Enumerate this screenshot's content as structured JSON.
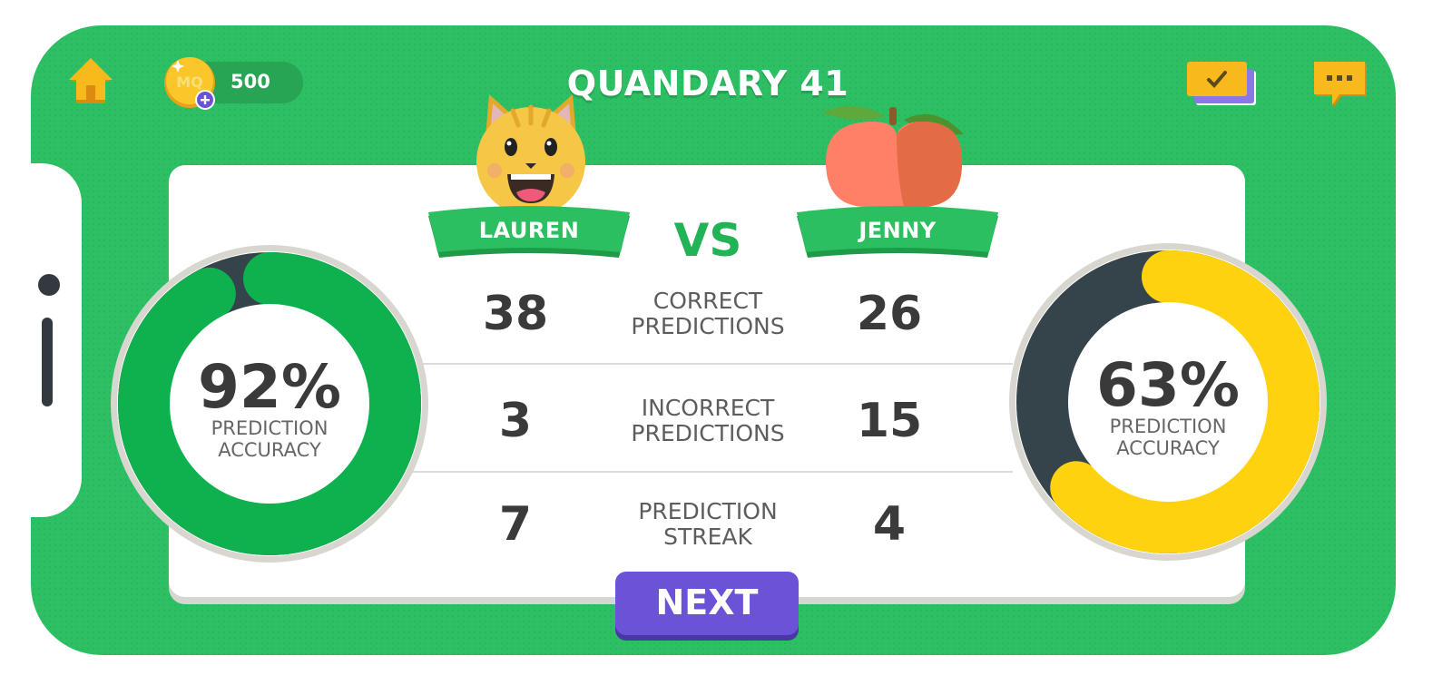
{
  "header": {
    "title": "QUANDARY 41",
    "coins": "500",
    "coin_logo_text": "MQ",
    "icons": [
      "home-icon",
      "coin-icon",
      "cards-icon",
      "chat-icon"
    ]
  },
  "players": {
    "left": {
      "name": "LAUREN",
      "avatar": "cat-emoji-icon",
      "accuracy": "92%",
      "accuracy_value": 0.92
    },
    "right": {
      "name": "JENNY",
      "avatar": "peach-emoji-icon",
      "accuracy": "63%",
      "accuracy_value": 0.63
    },
    "vs": "VS"
  },
  "stats": [
    {
      "label": "CORRECT\nPREDICTIONS",
      "left": "38",
      "right": "26"
    },
    {
      "label": "INCORRECT\nPREDICTIONS",
      "left": "3",
      "right": "15"
    },
    {
      "label": "PREDICTION\nSTREAK",
      "left": "7",
      "right": "4"
    }
  ],
  "accuracy_label": "PREDICTION\nACCURACY",
  "next_label": "NEXT",
  "colors": {
    "background_green": "#2dbf63",
    "left_ring": "#0fb14f",
    "right_ring": "#ffd20f",
    "ring_track": "#35434b",
    "next_button": "#6b52d6",
    "icon_yellow": "#f7b91c"
  }
}
